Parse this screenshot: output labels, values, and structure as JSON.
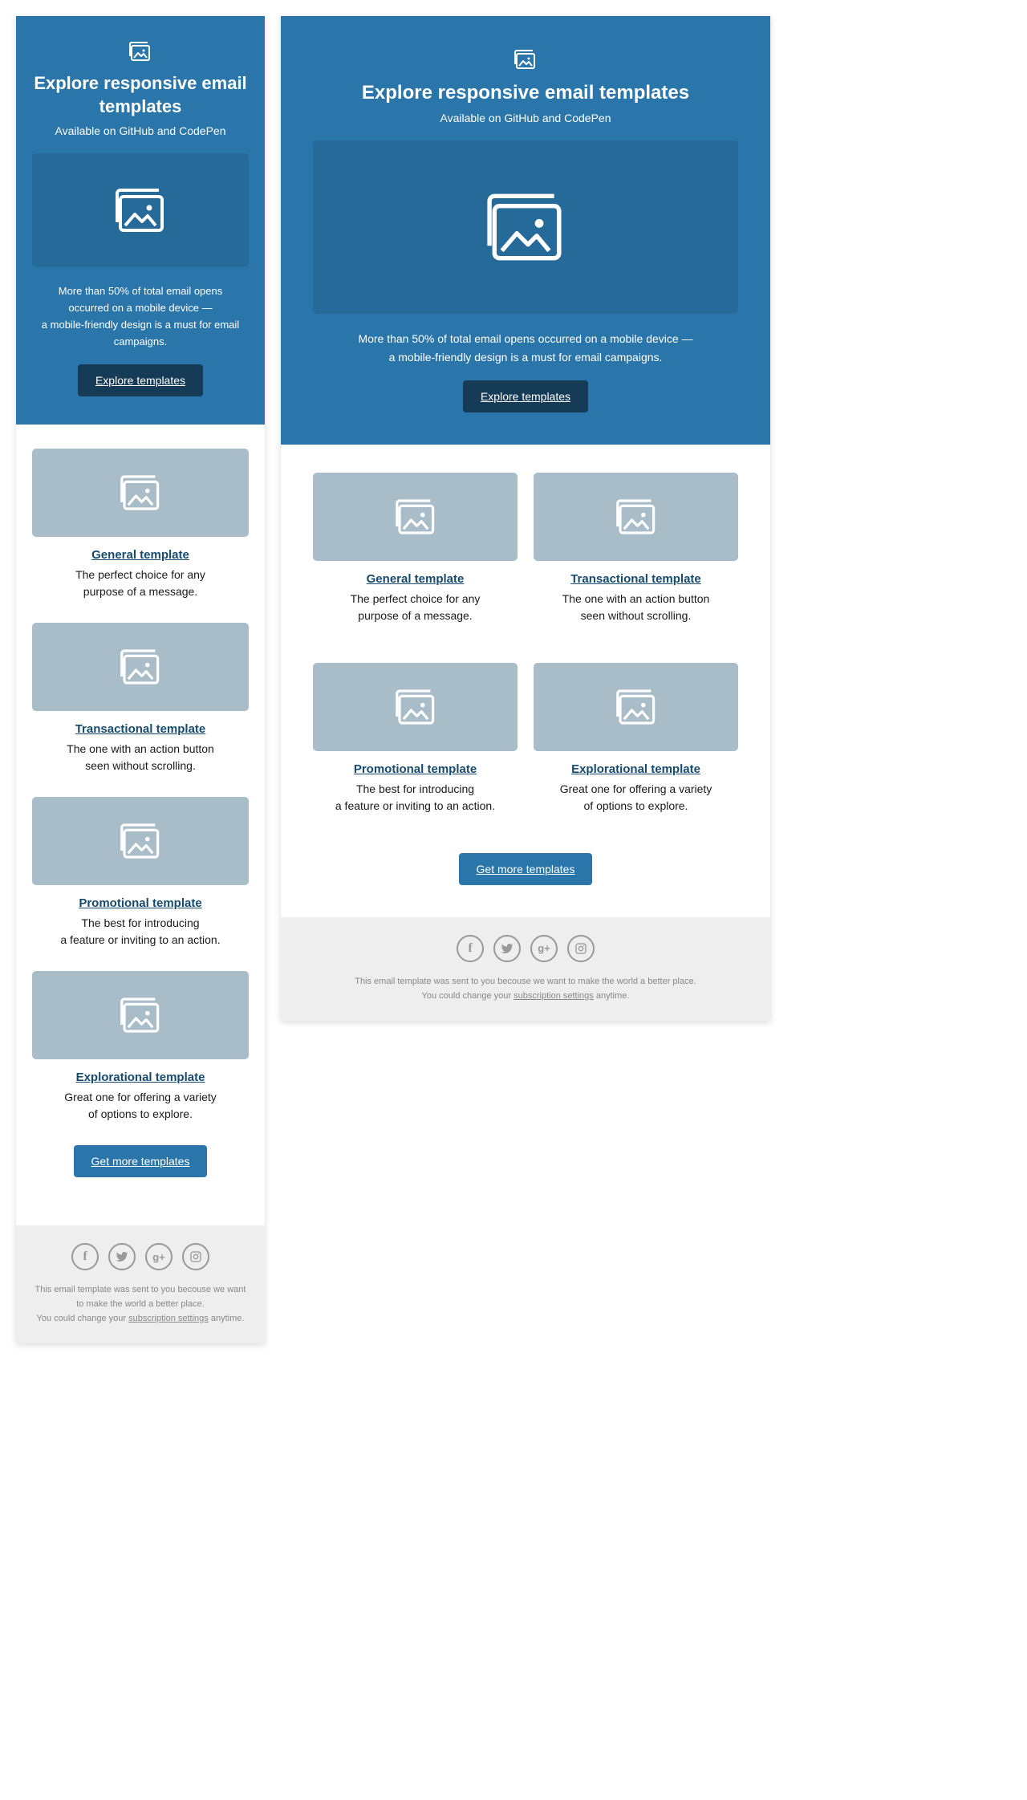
{
  "hero": {
    "title_narrow": "Explore responsive email templates",
    "title_wide": "Explore responsive email templates",
    "subtitle": "Available on GitHub and CodePen",
    "description_line1": "More than 50% of total email opens occurred on a mobile device —",
    "description_line2": "a mobile-friendly design is a must for email campaigns.",
    "cta": "Explore templates"
  },
  "cards": [
    {
      "title": "General template",
      "desc1": "The perfect choice for any",
      "desc2": "purpose of a message."
    },
    {
      "title": "Transactional template",
      "desc1": "The one with an action button",
      "desc2": "seen without scrolling."
    },
    {
      "title": "Promotional template",
      "desc1": "The best for introducing",
      "desc2": "a feature or inviting to an action."
    },
    {
      "title": "Explorational template",
      "desc1": "Great one for offering a variety",
      "desc2": "of options to explore."
    }
  ],
  "secondary_cta": "Get more templates",
  "footer": {
    "line1": "This email template was sent to you becouse we want to make the world a better place.",
    "line2_before": "You could change your ",
    "line2_link": "subscription settings",
    "line2_after": " anytime."
  },
  "icons": {
    "image": "image-icon",
    "facebook": "f",
    "twitter": "twitter",
    "gplus": "g+",
    "instagram": "instagram"
  },
  "colors": {
    "primary": "#2a75a9",
    "primary_dark": "#256a99",
    "button_dark": "#153b57",
    "card_bg": "#a9bdc9",
    "footer_bg": "#eeeeee",
    "link": "#164a6e"
  }
}
